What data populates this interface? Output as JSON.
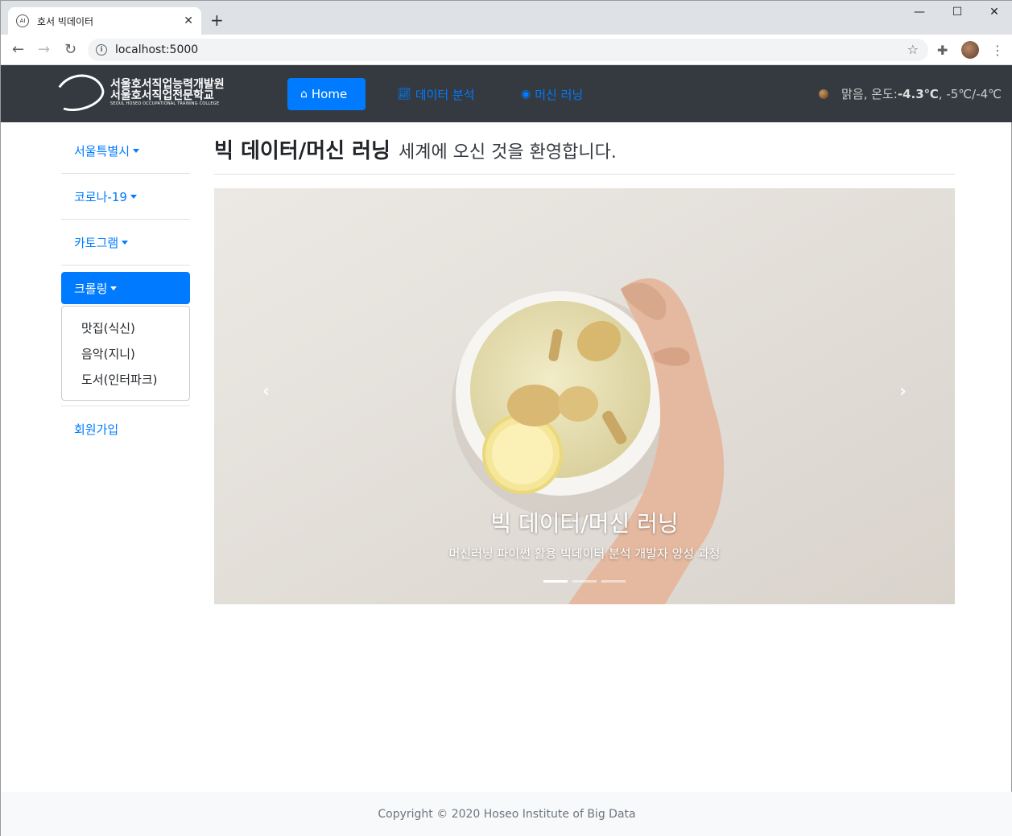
{
  "browser": {
    "tab_title": "호서 빅데이터",
    "tab_favicon": "AI",
    "url": "localhost:5000",
    "new_tab_symbol": "+",
    "close_symbol": "✕",
    "minimize_symbol": "—",
    "maximize_symbol": "☐",
    "window_close_symbol": "✕"
  },
  "navbar": {
    "logo_line1": "서울호서직업능력개발원",
    "logo_line2": "서울호서직업전문학교",
    "logo_line3": "SEOUL HOSEO OCCUPATIONAL TRAINING COLLEGE",
    "links": [
      {
        "label": "Home",
        "icon": "home-icon",
        "active": true
      },
      {
        "label": "데이터 분석",
        "icon": "chart-line-icon",
        "active": false
      },
      {
        "label": "머신 러닝",
        "icon": "brain-icon",
        "active": false
      }
    ],
    "weather": {
      "condition": "맑음, 온도: ",
      "temp": "-4.3℃",
      "range": ", -5℃/-4℃"
    }
  },
  "sidebar": {
    "items": [
      {
        "label": "서울특별시"
      },
      {
        "label": "코로나-19"
      },
      {
        "label": "카토그램"
      }
    ],
    "active": {
      "label": "크롤링"
    },
    "dropdown": [
      "맛집(식신)",
      "음악(지니)",
      "도서(인터파크)"
    ],
    "signup": "회원가입"
  },
  "main": {
    "heading_strong": "빅 데이터/머신 러닝",
    "heading_sub": "세계에 오신 것을 환영합니다.",
    "carousel": {
      "title": "빅 데이터/머신 러닝",
      "subtitle": "머신러닝 파이썬 활용 빅데이터 분석 개발자 양성 과정",
      "prev": "‹",
      "next": "›",
      "slides": 3,
      "active_slide": 1
    }
  },
  "footer": {
    "text": "Copyright © 2020 Hoseo Institute of Big Data"
  },
  "colors": {
    "primary": "#007bff",
    "navbar_bg": "#343a40",
    "footer_bg": "#f8f9fa"
  }
}
